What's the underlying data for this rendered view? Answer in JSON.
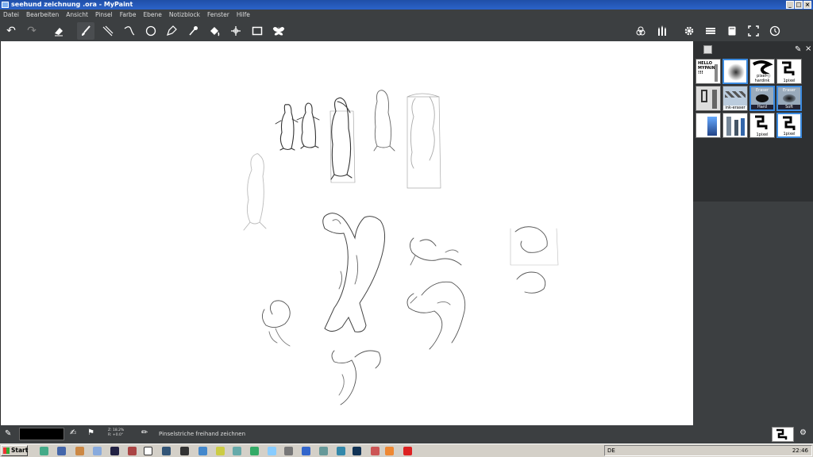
{
  "window": {
    "title": "seehund zeichnung .ora - MyPaint",
    "buttons": [
      "_",
      "□",
      "×"
    ]
  },
  "menu": [
    "Datei",
    "Bearbeiten",
    "Ansicht",
    "Pinsel",
    "Farbe",
    "Ebene",
    "Notizblock",
    "Fenster",
    "Hilfe"
  ],
  "toolbar": {
    "icons": [
      "undo-icon",
      "redo-icon",
      "eraser-icon",
      "brush-icon",
      "lines-icon",
      "curve-icon",
      "ellipse-icon",
      "ink-icon",
      "eyedropper-icon",
      "fill-icon",
      "move-icon",
      "frame-icon",
      "symmetry-icon"
    ],
    "right_icons": [
      "color-wheel-icon",
      "brushes-icon",
      "gear-icon",
      "layers-icon",
      "scratchpad-icon",
      "fullscreen-icon",
      "history-icon"
    ]
  },
  "brushes": {
    "items": [
      {
        "label": "",
        "kind": "hello"
      },
      {
        "label": "",
        "kind": "airbrush",
        "selected": true
      },
      {
        "label": "pixel-hardink",
        "kind": "scribble"
      },
      {
        "label": "1pixel",
        "kind": "pixel"
      },
      {
        "label": "",
        "kind": "tools"
      },
      {
        "label": "ink-eraser",
        "kind": "eraser"
      },
      {
        "label": "Hard",
        "kind": "hard",
        "selected": true
      },
      {
        "label": "Soft",
        "kind": "soft",
        "selected": true
      },
      {
        "label": "",
        "kind": "blue"
      },
      {
        "label": "",
        "kind": "pencils"
      },
      {
        "label": "1pixel",
        "kind": "pixel"
      },
      {
        "label": "1pixel",
        "kind": "pixel",
        "selected": true
      }
    ],
    "hello_text": "HELLO MYPAINT !!!",
    "eraser_text": "Eraser"
  },
  "status": {
    "zoom": "Z: 18.2%",
    "rotation": "R: +0.0°",
    "message": "Pinselstriche freihand zeichnen",
    "color": "#000000"
  },
  "taskbar": {
    "start_label": "Start",
    "language": "DE",
    "clock": "22:46"
  }
}
